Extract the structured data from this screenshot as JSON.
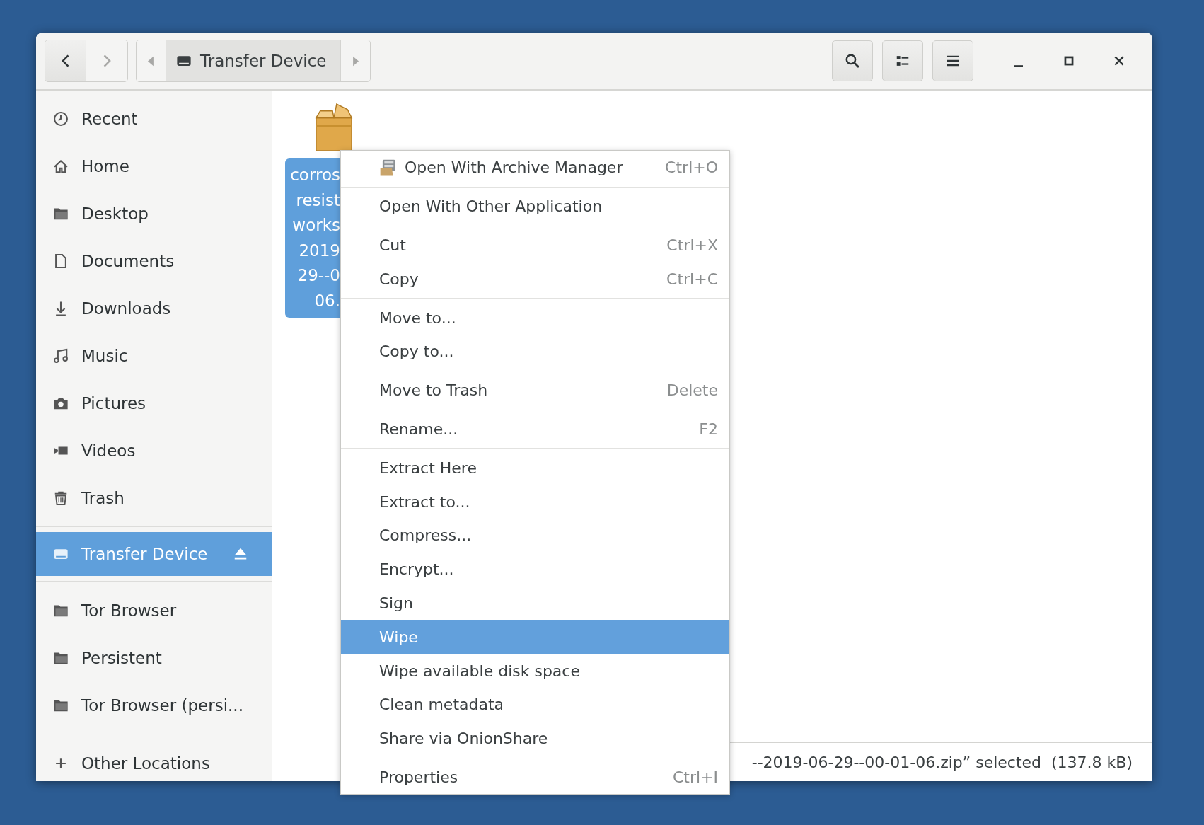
{
  "header": {
    "back": {
      "disabled": false
    },
    "forward": {
      "disabled": true
    },
    "path": {
      "scroll_left_disabled": true,
      "scroll_right_disabled": true,
      "crumbs": [
        {
          "label": "Transfer Device",
          "selected": true
        }
      ]
    }
  },
  "sidebar": {
    "sections": [
      [
        {
          "label": "Recent",
          "kind": "recent",
          "selected": false
        },
        {
          "label": "Home",
          "kind": "home",
          "selected": false
        },
        {
          "label": "Desktop",
          "kind": "folder",
          "selected": false
        },
        {
          "label": "Documents",
          "kind": "document",
          "selected": false
        },
        {
          "label": "Downloads",
          "kind": "download",
          "selected": false
        },
        {
          "label": "Music",
          "kind": "music",
          "selected": false
        },
        {
          "label": "Pictures",
          "kind": "camera",
          "selected": false
        },
        {
          "label": "Videos",
          "kind": "video",
          "selected": false
        },
        {
          "label": "Trash",
          "kind": "trash",
          "selected": false
        }
      ],
      [
        {
          "label": "Transfer Device",
          "kind": "drive",
          "selected": true,
          "ejectable": true
        }
      ],
      [
        {
          "label": "Tor Browser",
          "kind": "folder",
          "selected": false
        },
        {
          "label": "Persistent",
          "kind": "folder",
          "selected": false
        },
        {
          "label": "Tor Browser (persi...",
          "kind": "folder",
          "selected": false
        }
      ],
      [
        {
          "label": "Other Locations",
          "kind": "plus",
          "selected": false
        }
      ]
    ]
  },
  "files": [
    {
      "name_lines": [
        "corros",
        "resist",
        "works",
        "2019",
        "29--0",
        "06."
      ],
      "selected": true
    }
  ],
  "context_menu": {
    "groups": [
      [
        {
          "label": "Open With Archive Manager",
          "shortcut": "Ctrl+O",
          "kind": "app",
          "selected": false
        }
      ],
      [
        {
          "label": "Open With Other Application",
          "kind": "plain",
          "selected": false
        }
      ],
      [
        {
          "label": "Cut",
          "shortcut": "Ctrl+X",
          "kind": "plain",
          "selected": false
        },
        {
          "label": "Copy",
          "shortcut": "Ctrl+C",
          "kind": "plain",
          "selected": false
        }
      ],
      [
        {
          "label": "Move to...",
          "kind": "plain",
          "selected": false
        },
        {
          "label": "Copy to...",
          "kind": "plain",
          "selected": false
        }
      ],
      [
        {
          "label": "Move to Trash",
          "shortcut": "Delete",
          "kind": "plain",
          "selected": false
        }
      ],
      [
        {
          "label": "Rename...",
          "shortcut": "F2",
          "kind": "plain",
          "selected": false
        }
      ],
      [
        {
          "label": "Extract Here",
          "kind": "plain",
          "selected": false
        },
        {
          "label": "Extract to...",
          "kind": "plain",
          "selected": false
        },
        {
          "label": "Compress...",
          "kind": "plain",
          "selected": false
        },
        {
          "label": "Encrypt...",
          "kind": "plain",
          "selected": false
        },
        {
          "label": "Sign",
          "kind": "plain",
          "selected": false
        },
        {
          "label": "Wipe",
          "kind": "plain",
          "selected": true
        },
        {
          "label": "Wipe available disk space",
          "kind": "plain",
          "selected": false
        },
        {
          "label": "Clean metadata",
          "kind": "plain",
          "selected": false
        },
        {
          "label": "Share via OnionShare",
          "kind": "plain",
          "selected": false
        }
      ],
      [
        {
          "label": "Properties",
          "shortcut": "Ctrl+I",
          "kind": "plain",
          "selected": false
        }
      ]
    ]
  },
  "status": "--2019-06-29--00-01-06.zip” selected  (137.8 kB)"
}
